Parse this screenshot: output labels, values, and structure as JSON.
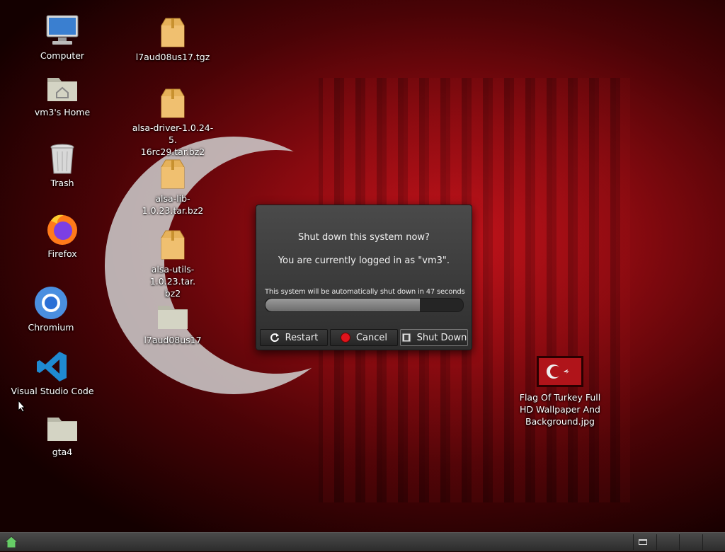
{
  "desktop": {
    "icons": [
      {
        "label": "Computer",
        "icon": "computer-icon"
      },
      {
        "label": "vm3's Home",
        "icon": "home-folder-icon"
      },
      {
        "label": "Trash",
        "icon": "trash-icon"
      },
      {
        "label": "Firefox",
        "icon": "firefox-icon"
      },
      {
        "label": "Chromium",
        "icon": "chromium-icon"
      },
      {
        "label": "Visual Studio Code",
        "icon": "vscode-icon"
      },
      {
        "label": "gta4",
        "icon": "folder-icon"
      },
      {
        "label": "l7aud08us17.tgz",
        "icon": "archive-icon"
      },
      {
        "label": "alsa-driver-1.0.24-5.16rc29.tar.bz2",
        "label_line1": "alsa-driver-1.0.24-5.",
        "label_line2": "16rc29.tar.bz2",
        "icon": "archive-icon"
      },
      {
        "label": "alsa-lib-1.0.23.tar.bz2",
        "icon": "archive-icon"
      },
      {
        "label": "alsa-utils-1.0.23.tar.bz2",
        "label_line1": "alsa-utils-1.0.23.tar.",
        "label_line2": "bz2",
        "icon": "archive-icon"
      },
      {
        "label": "l7aud08us17",
        "icon": "folder-icon"
      },
      {
        "label": "Flag Of Turkey Full HD Wallpaper And Background.jpg",
        "label_line1": "Flag Of Turkey Full",
        "label_line2": "HD Wallpaper And",
        "label_line3": "Background.jpg",
        "icon": "image-thumbnail-icon"
      }
    ]
  },
  "dialog": {
    "question": "Shut down this system now?",
    "logged_in": "You are currently logged in as \"vm3\".",
    "countdown": "This system will be automatically shut down in 47 seconds",
    "progress_fraction": 0.78,
    "buttons": {
      "restart": "Restart",
      "cancel": "Cancel",
      "shutdown": "Shut Down"
    }
  },
  "colors": {
    "wallpaper_red": "#c0121a",
    "cancel_red": "#e0141c",
    "vscode_blue": "#1f8ad2"
  }
}
